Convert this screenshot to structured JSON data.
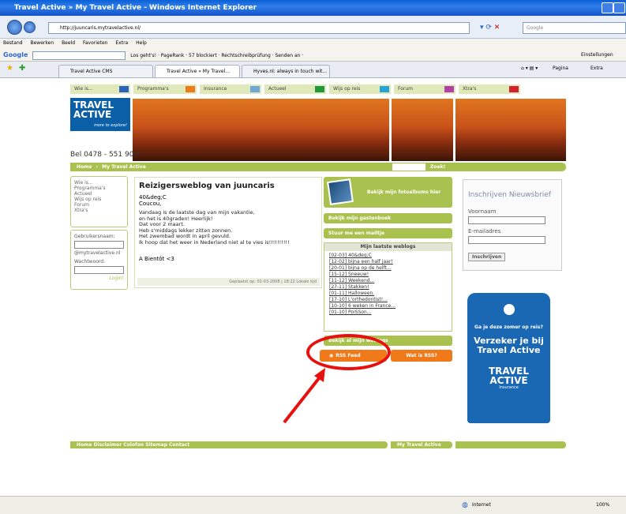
{
  "window": {
    "title": "Travel Active » My Travel Active - Windows Internet Explorer"
  },
  "address": {
    "url": "http://juuncaris.mytravelactive.nl/",
    "search_placeholder": "Google"
  },
  "menu": [
    "Bestand",
    "Bewerken",
    "Beeld",
    "Favorieten",
    "Extra",
    "Help"
  ],
  "googlebar": {
    "logo": "Google",
    "text": "Los geht's! · PageRank · 57 blockiert · Rechtschreibprüfung · Senden an ·",
    "settings": "Einstellungen"
  },
  "tabs": [
    "Travel Active CMS",
    "Travel Active » My Travel...",
    "Hyves.nl: always in touch wit..."
  ],
  "commandbar": {
    "page": "Pagina",
    "extra": "Extra"
  },
  "site": {
    "nav": [
      {
        "label": "Wie is...",
        "color": "#2a63c0"
      },
      {
        "label": "Programma's",
        "color": "#f07a1a"
      },
      {
        "label": "Insurance",
        "color": "#6ea7d8"
      },
      {
        "label": "Actueel",
        "color": "#1f9a3a"
      },
      {
        "label": "Wijs op reis",
        "color": "#23a3d8"
      },
      {
        "label": "Forum",
        "color": "#b43fa6"
      },
      {
        "label": "Xtra's",
        "color": "#d8202c"
      }
    ],
    "logo_line1": "TRAVEL",
    "logo_line2": "ACTIVE",
    "logo_tag": "more to explore!",
    "phone": "Bel 0478 - 551 900",
    "breadcrumb": [
      "Home",
      "My Travel Active"
    ],
    "search_button": "Zoek!",
    "left_links": [
      "Wie is...",
      "Programma's",
      "Actueel",
      "Wijs op reis",
      "Forum",
      "Xtra's"
    ],
    "login": {
      "username_label": "Gebruikersnaam:",
      "domain": "@mytravelactive.nl",
      "password_label": "Wachtwoord:",
      "login_button": "Login!"
    },
    "blog": {
      "title": "Reizigersweblog van juuncaris",
      "subtitle": "40&deg;C",
      "greeting": "Coucou,",
      "body": "Vandaag is de laatste dag van mijn vakantie,\nen het is 40graden! Heerlijk!\nDat voor 2 maart.\nHeb s'middags lekker zitten zonnen.\nHet zwembad wordt in april gevuld.\nIk hoop dat het weer in Nederland niet al te vies is!!!!!!!!!!",
      "signoff": "A Bientôt <3",
      "footer": "Geplaatst op: 02-03-2008 | 18:22 Lokale tijd"
    },
    "photo_button": "Bekijk mijn fotoalbums hier",
    "guestbook_button": "Bekijk mijn gastenboek",
    "mail_button": "Stuur me een mailtje",
    "weblogs_header": "Mijn laatste weblogs",
    "weblogs": [
      "[02-03] 40&deg;C",
      "[12-02] bijna een half jaar!",
      "[20-01] bijna op de helft...",
      "[15-12] Sneeuw!",
      "[11-12] Weekend...",
      "[27-11] Stakken!",
      "[01-11] Halloween.",
      "[17-10] L'orthedontist!...",
      "[10-10] 6 weken in France...",
      "[01-10] PoiSSon..."
    ],
    "all_weblogs_button": "Bekijk al mijn weblogs",
    "rss_feed": "RSS Feed",
    "what_is_rss": "Wat is RSS?",
    "newsletter": {
      "title": "Inschrijven Nieuwsbrief",
      "name_label": "Voornaam",
      "email_label": "E-mailadres",
      "button": "Inschrijven"
    },
    "ad": {
      "question": "Ga je deze zomer op reis?",
      "headline": "Verzeker je bij Travel Active",
      "logo1": "TRAVEL",
      "logo2": "ACTIVE",
      "sub": "Insurance"
    },
    "footer_links": [
      "Home",
      "Disclaimer",
      "Colofon",
      "Sitemap",
      "Contact"
    ],
    "footer_mta": "My Travel Active"
  },
  "status": {
    "zone": "Internet",
    "zoom": "100%"
  }
}
